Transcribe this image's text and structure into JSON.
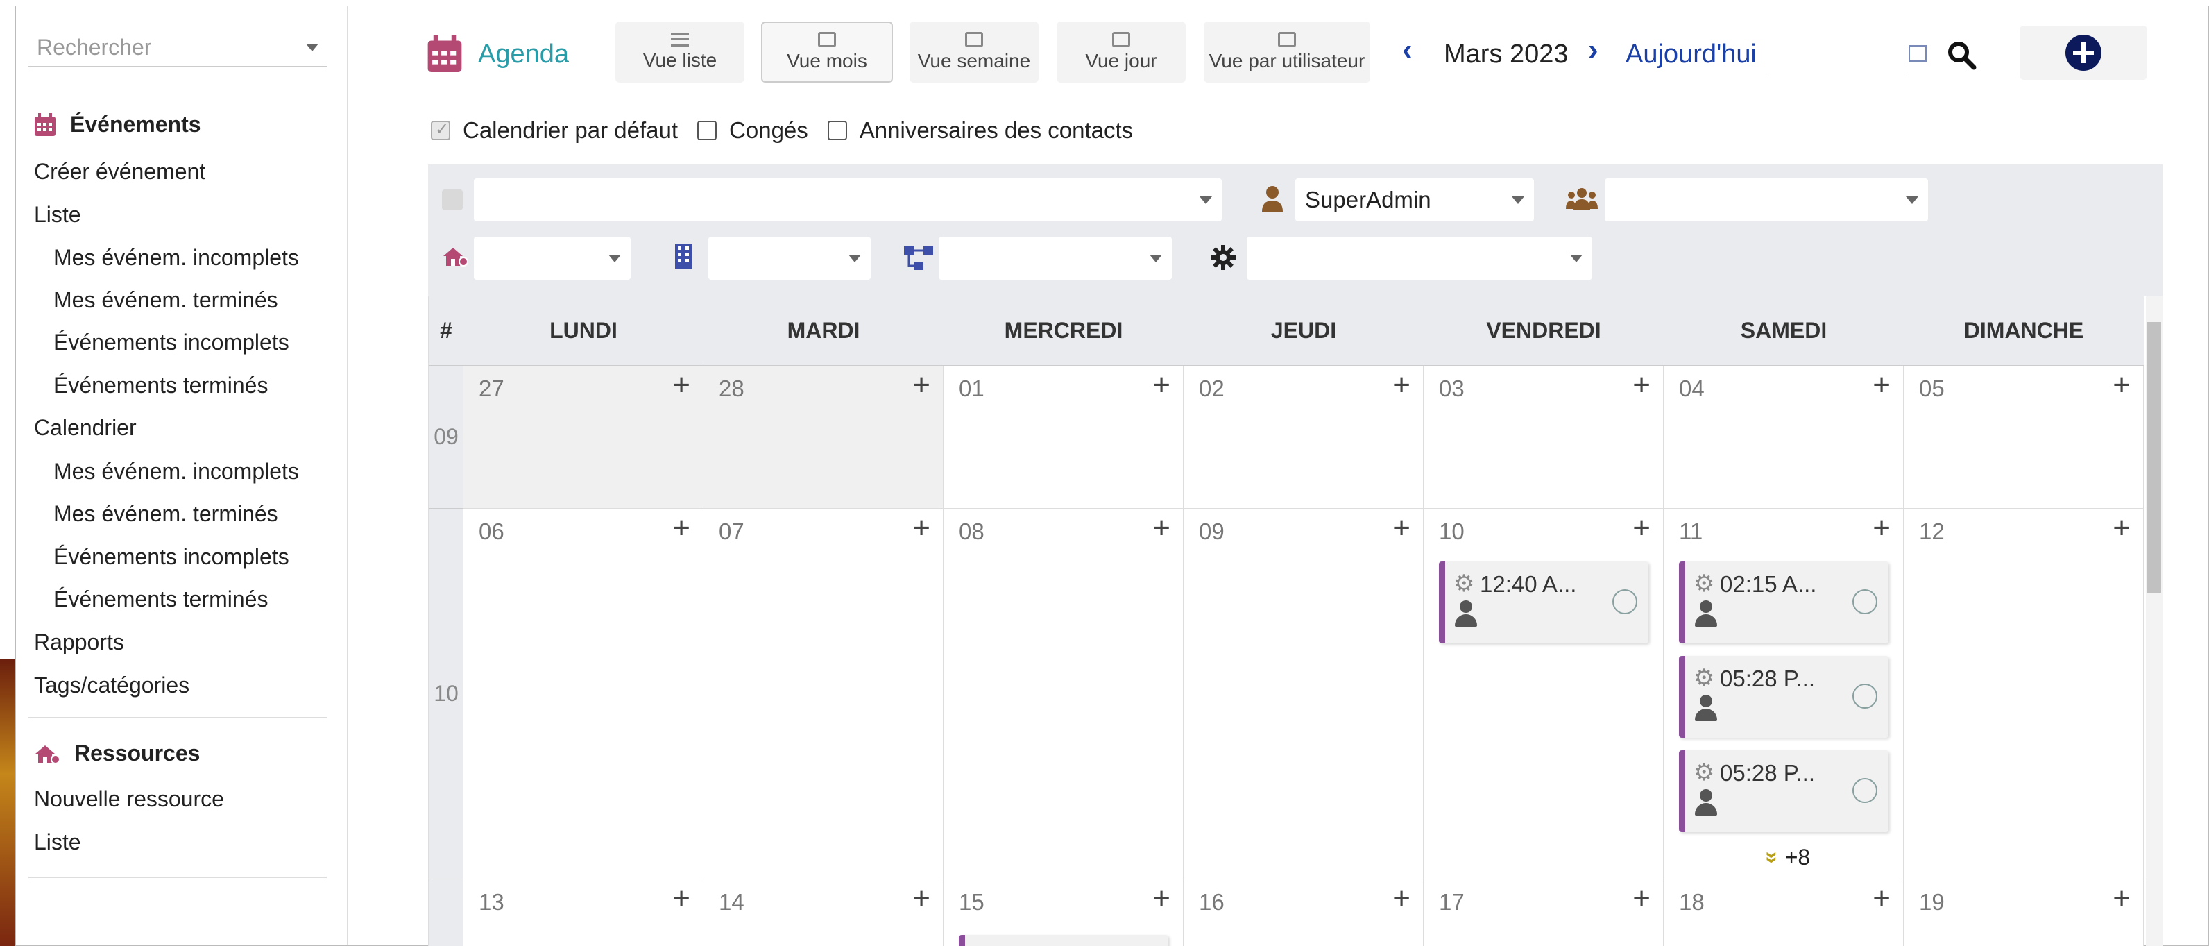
{
  "sidebar": {
    "search_placeholder": "Rechercher",
    "events_header": "Événements",
    "items": [
      "Créer événement",
      "Liste",
      "Mes événem. incomplets",
      "Mes événem. terminés",
      "Événements incomplets",
      "Événements terminés",
      "Calendrier",
      "Mes événem. incomplets",
      "Mes événem. terminés",
      "Événements incomplets",
      "Événements terminés",
      "Rapports",
      "Tags/catégories"
    ],
    "resources_header": "Ressources",
    "res_items": [
      "Nouvelle ressource",
      "Liste"
    ]
  },
  "toolbar": {
    "title": "Agenda",
    "views": [
      "Vue liste",
      "Vue mois",
      "Vue semaine",
      "Vue jour",
      "Vue par utilisateur"
    ],
    "month": "Mars 2023",
    "today": "Aujourd'hui",
    "accent": "#2a9ca8"
  },
  "checkboxes": [
    "Calendrier par défaut",
    "Congés",
    "Anniversaires des contacts"
  ],
  "filters": {
    "user": "SuperAdmin"
  },
  "calendar": {
    "week_col": "#",
    "days": [
      "LUNDI",
      "MARDI",
      "MERCREDI",
      "JEUDI",
      "VENDREDI",
      "SAMEDI",
      "DIMANCHE"
    ],
    "weeks": [
      {
        "num": "09",
        "dates": [
          "27",
          "28",
          "01",
          "02",
          "03",
          "04",
          "05"
        ]
      },
      {
        "num": "10",
        "dates": [
          "06",
          "07",
          "08",
          "09",
          "10",
          "11",
          "12"
        ]
      },
      {
        "num": "",
        "dates": [
          "13",
          "14",
          "15",
          "16",
          "17",
          "18",
          "19"
        ]
      }
    ],
    "events": [
      {
        "day": 4,
        "time": "12:40 A..."
      },
      {
        "day": 5,
        "time": "02:15 A..."
      },
      {
        "day": 5,
        "time": "05:28 P..."
      },
      {
        "day": 5,
        "time": "05:28 P..."
      }
    ],
    "more": "+8",
    "event_color": "#8a4e9b"
  }
}
